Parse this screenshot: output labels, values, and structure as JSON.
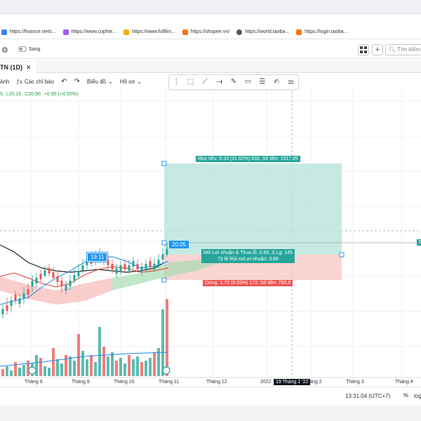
{
  "bookmarks": [
    {
      "label": "https://finance.viets...",
      "color": "#3b82f6"
    },
    {
      "label": "https://www.cophie...",
      "color": "#a855f7"
    },
    {
      "label": "https://www.fullfim...",
      "color": "#eab308"
    },
    {
      "label": "https://shopee.vn/",
      "color": "#f97316"
    },
    {
      "label": "https://world.taoba...",
      "color": "#555555"
    },
    {
      "label": "https://login.taoba...",
      "color": "#f97316"
    }
  ],
  "toolbar": {
    "toggle_label": "Sáng",
    "search_placeholder": "Tìm kiếm",
    "plus_label": "+"
  },
  "tab": {
    "label": "TN (1D)",
    "close": "✕"
  },
  "chart_toolbar": {
    "item0": "ảnh",
    "indicators": "Các chỉ báo",
    "undo": "↶",
    "redo": "↷",
    "chart_type": "Biểu đồ",
    "profile": "Hồ sơ"
  },
  "ohlc": {
    "o": "5",
    "l": "L20.15",
    "c": "C20.90",
    "chg": "+0.90 (+4.50%)"
  },
  "position_tool": {
    "target_label": "Mục tiêu: 6.33 (31.62%) 633, Số tiền: 1917.85",
    "entry_label": "20.05",
    "pnl_label": "Mở Lợi nhuận & Thua lỗ: 0.88, S.Lg: 145",
    "ratio_label": "Tỷ lệ Rủi ro/Lợi nhuận: 3.68",
    "stop_label": "Dừng: 1.72 (8.59%) 172, Số tiền: 750.6",
    "hl_label": "19.11",
    "price_axis_tag": "6"
  },
  "x_axis": {
    "ticks": [
      "Tháng 8",
      "Tháng 9",
      "Tháng 10",
      "Tháng 11",
      "Tháng 12",
      "2022",
      "Tháng 2",
      "Tháng 3",
      "Tháng 4"
    ],
    "crosshair_label": "19 Tháng 1 '22"
  },
  "footer": {
    "time": "13:31:04 (UTC+7)",
    "pct": "%",
    "log": "log"
  },
  "colors": {
    "up": "#26a69a",
    "down": "#ef5350",
    "target_fill": "#b9e4dc",
    "stop_fill": "#f9c9c7"
  }
}
